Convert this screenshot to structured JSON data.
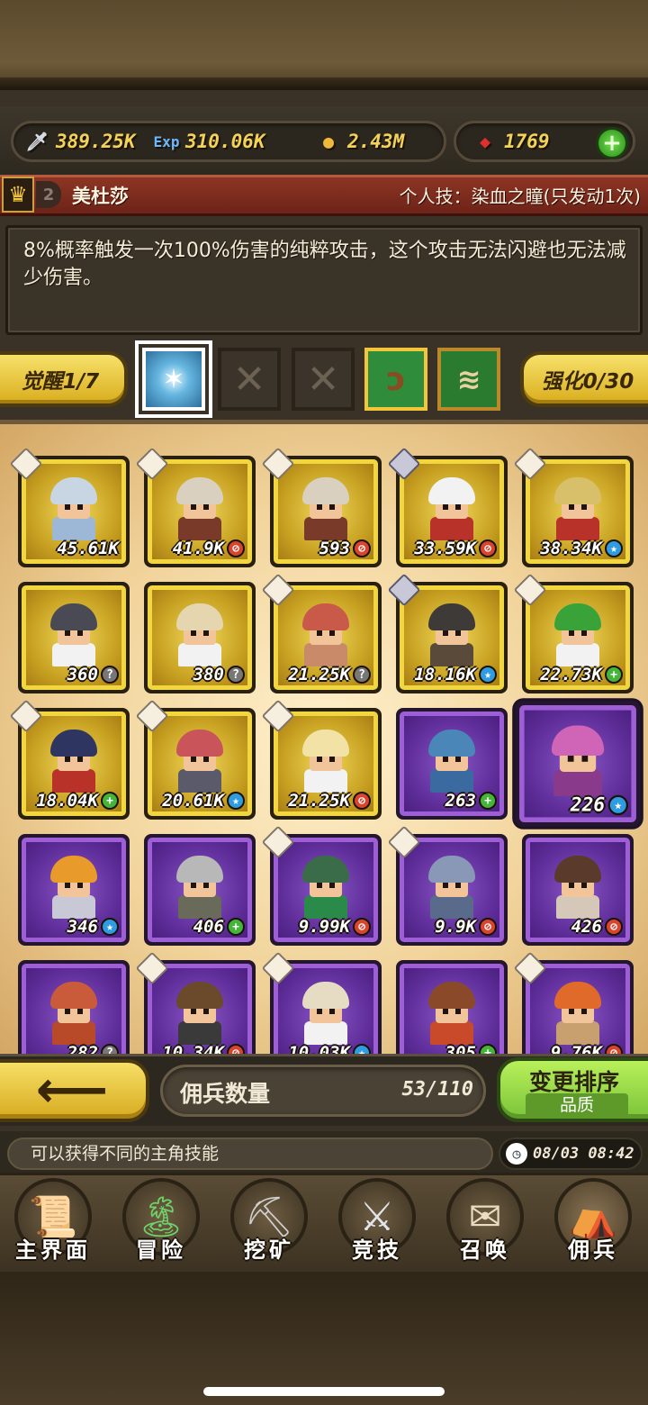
{
  "resources": {
    "attack": {
      "icon": "sword-icon",
      "value": "389.25K"
    },
    "exp": {
      "icon": "exp-icon",
      "value": "310.06K"
    },
    "gold": {
      "icon": "coin-icon",
      "value": "2.43M"
    },
    "gem": {
      "icon": "ruby-icon",
      "value": "1769"
    },
    "add_label": "+"
  },
  "hero": {
    "rank": "2",
    "name": "美杜莎",
    "skill_title": "个人技：染血之瞳(只发动1次)",
    "description": "8%概率触发一次100%伤害的纯粹攻击，这个攻击无法闪避也无法减少伤害。"
  },
  "awaken": {
    "label": "觉醒1/7",
    "enhance_label": "强化0/30",
    "locked_mark": "✕"
  },
  "mercenaries": [
    {
      "value": "45.61K",
      "badge": "",
      "tier": "gold",
      "tag": "paper"
    },
    {
      "value": "41.9K",
      "badge": "red",
      "tier": "gold",
      "tag": "paper"
    },
    {
      "value": "593",
      "badge": "red",
      "tier": "gold",
      "tag": "paper"
    },
    {
      "value": "33.59K",
      "badge": "red",
      "tier": "gold",
      "tag": "sword"
    },
    {
      "value": "38.34K",
      "badge": "blue",
      "tier": "gold",
      "tag": "paper"
    },
    {
      "value": "360",
      "badge": "gray",
      "tier": "gold",
      "tag": ""
    },
    {
      "value": "380",
      "badge": "gray",
      "tier": "gold",
      "tag": ""
    },
    {
      "value": "21.25K",
      "badge": "gray",
      "tier": "gold",
      "tag": "paper"
    },
    {
      "value": "18.16K",
      "badge": "blue",
      "tier": "gold",
      "tag": "sword"
    },
    {
      "value": "22.73K",
      "badge": "green",
      "tier": "gold",
      "tag": "paper"
    },
    {
      "value": "18.04K",
      "badge": "green",
      "tier": "gold",
      "tag": "paper"
    },
    {
      "value": "20.61K",
      "badge": "blue",
      "tier": "gold",
      "tag": "paper"
    },
    {
      "value": "21.25K",
      "badge": "red",
      "tier": "gold",
      "tag": "paper"
    },
    {
      "value": "263",
      "badge": "green",
      "tier": "purple",
      "tag": ""
    },
    {
      "value": "226",
      "badge": "blue",
      "tier": "purple",
      "tag": "",
      "selected": true
    },
    {
      "value": "346",
      "badge": "blue",
      "tier": "purple",
      "tag": ""
    },
    {
      "value": "406",
      "badge": "green",
      "tier": "purple",
      "tag": ""
    },
    {
      "value": "9.99K",
      "badge": "red",
      "tier": "purple",
      "tag": "paper"
    },
    {
      "value": "9.9K",
      "badge": "red",
      "tier": "purple",
      "tag": "paper"
    },
    {
      "value": "426",
      "badge": "red",
      "tier": "purple",
      "tag": ""
    },
    {
      "value": "282",
      "badge": "gray",
      "tier": "purple",
      "tag": ""
    },
    {
      "value": "10.34K",
      "badge": "red",
      "tier": "purple",
      "tag": "paper"
    },
    {
      "value": "10.03K",
      "badge": "blue",
      "tier": "purple",
      "tag": "paper"
    },
    {
      "value": "305",
      "badge": "green",
      "tier": "purple",
      "tag": ""
    },
    {
      "value": "9.76K",
      "badge": "red",
      "tier": "purple",
      "tag": "paper"
    }
  ],
  "footer": {
    "back_icon": "arrow-left-icon",
    "count_label": "佣兵数量",
    "count_value": "53/110",
    "sort_label": "变更排序",
    "sort_sub": "品质"
  },
  "tip": {
    "text": "可以获得不同的主角技能",
    "time": "08/03 08:42",
    "clock_icon": "clock-icon"
  },
  "nav": [
    {
      "label": "主界面",
      "icon": "scroll-map-icon"
    },
    {
      "label": "冒险",
      "icon": "island-icon"
    },
    {
      "label": "挖矿",
      "icon": "pickaxe-icon"
    },
    {
      "label": "竞技",
      "icon": "crossed-swords-icon"
    },
    {
      "label": "召唤",
      "icon": "summon-scroll-icon"
    },
    {
      "label": "佣兵",
      "icon": "tent-icon"
    }
  ],
  "colors": {
    "gold_card": "#f2d640",
    "purple_card": "#9d5ed6",
    "accent_green": "#7bc43a"
  }
}
